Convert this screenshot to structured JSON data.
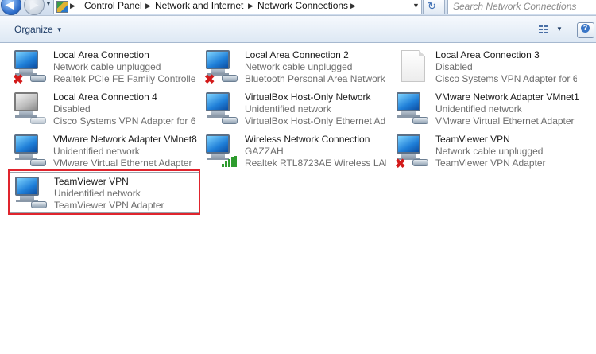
{
  "address": {
    "breadcrumbs": [
      "Control Panel",
      "Network and Internet",
      "Network Connections"
    ],
    "search_placeholder": "Search Network Connections"
  },
  "toolbar": {
    "organize_label": "Organize"
  },
  "connections": [
    {
      "name": "Local Area Connection",
      "status": "Network cable unplugged",
      "device": "Realtek PCIe FE Family Controller",
      "icon": "network-adapter-disconnected-icon"
    },
    {
      "name": "Local Area Connection 2",
      "status": "Network cable unplugged",
      "device": "Bluetooth Personal Area Network",
      "icon": "network-adapter-disconnected-icon"
    },
    {
      "name": "Local Area Connection 3",
      "status": "Disabled",
      "device": "Cisco Systems VPN Adapter for 6...",
      "icon": "blank-document-icon"
    },
    {
      "name": "Local Area Connection 4",
      "status": "Disabled",
      "device": "Cisco Systems VPN Adapter for 6...",
      "icon": "network-adapter-disabled-icon"
    },
    {
      "name": "VirtualBox Host-Only Network",
      "status": "Unidentified network",
      "device": "VirtualBox Host-Only Ethernet Ad...",
      "icon": "network-adapter-icon"
    },
    {
      "name": "VMware Network Adapter VMnet1",
      "status": "Unidentified network",
      "device": "VMware Virtual Ethernet Adapter ...",
      "icon": "network-adapter-icon"
    },
    {
      "name": "VMware Network Adapter VMnet8",
      "status": "Unidentified network",
      "device": "VMware Virtual Ethernet Adapter ...",
      "icon": "network-adapter-icon"
    },
    {
      "name": "Wireless Network Connection",
      "status": "GAZZAH",
      "device": "Realtek RTL8723AE Wireless LAN ...",
      "icon": "wireless-adapter-icon"
    },
    {
      "name": "TeamViewer VPN",
      "status": "Network cable unplugged",
      "device": "TeamViewer VPN Adapter",
      "icon": "network-adapter-disconnected-icon"
    },
    {
      "name": "TeamViewer VPN",
      "status": "Unidentified network",
      "device": "TeamViewer VPN Adapter",
      "icon": "network-adapter-icon"
    }
  ],
  "colors": {
    "highlight_border": "#e0242d",
    "toolbar_text": "#1e3c66",
    "secondary_text": "#6d6d6d"
  }
}
